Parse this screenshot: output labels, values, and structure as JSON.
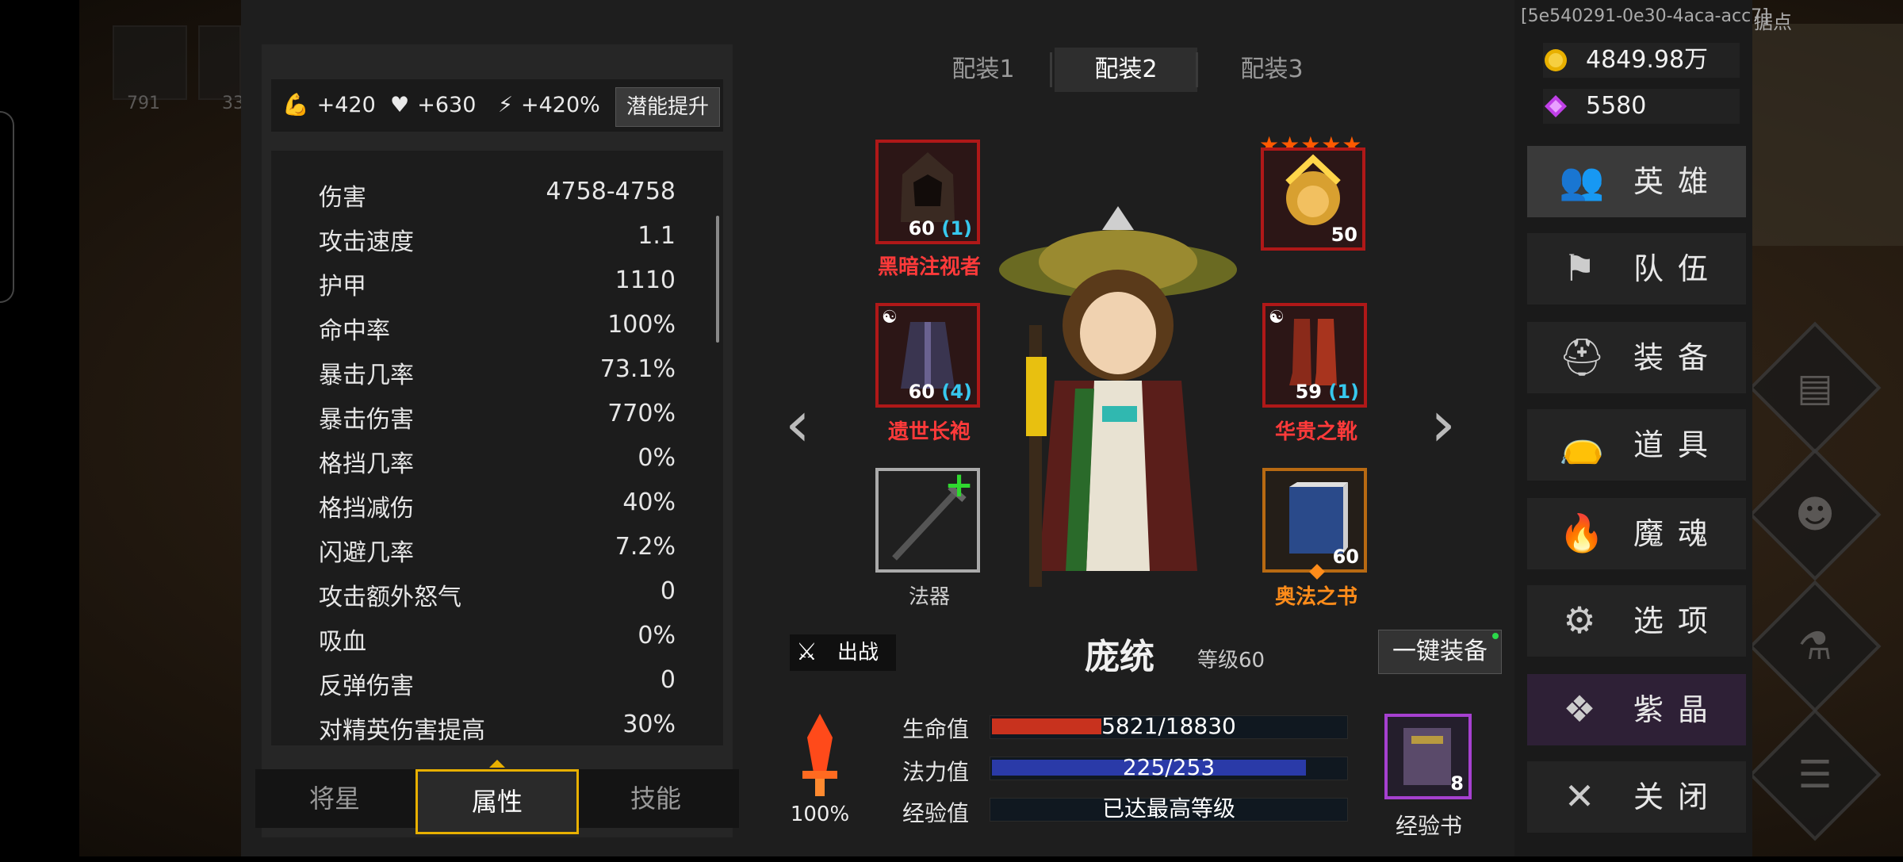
{
  "background": {
    "counts": [
      "791",
      "33"
    ],
    "stronghold_label": "据点"
  },
  "session_id": "[5e540291-0e30-4aca-acc7]",
  "potential": {
    "strength": "+420",
    "health": "+630",
    "energy": "+420%",
    "upgrade_button": "潜能提升"
  },
  "stats": [
    {
      "name": "伤害",
      "value": "4758-4758"
    },
    {
      "name": "攻击速度",
      "value": "1.1"
    },
    {
      "name": "护甲",
      "value": "1110"
    },
    {
      "name": "命中率",
      "value": "100%"
    },
    {
      "name": "暴击几率",
      "value": "73.1%"
    },
    {
      "name": "暴击伤害",
      "value": "770%"
    },
    {
      "name": "格挡几率",
      "value": "0%"
    },
    {
      "name": "格挡减伤",
      "value": "40%"
    },
    {
      "name": "闪避几率",
      "value": "7.2%"
    },
    {
      "name": "攻击额外怒气",
      "value": "0"
    },
    {
      "name": "吸血",
      "value": "0%"
    },
    {
      "name": "反弹伤害",
      "value": "0"
    },
    {
      "name": "对精英伤害提高",
      "value": "30%"
    }
  ],
  "bottom_tabs": [
    "将星",
    "属性",
    "技能"
  ],
  "loadout_tabs": [
    "配装1",
    "配装2",
    "配装3"
  ],
  "equipment": {
    "head": {
      "name": "黑暗注视者",
      "level": "60",
      "plus": "(1)"
    },
    "companion": {
      "level": "50",
      "stars": "★★★★★"
    },
    "body": {
      "name": "遗世长袍",
      "level": "60",
      "plus": "(4)"
    },
    "boots": {
      "name": "华贵之靴",
      "level": "59",
      "plus": "(1)"
    },
    "weapon": {
      "name": "法器"
    },
    "book": {
      "name": "奥法之书",
      "level": "60"
    }
  },
  "hero": {
    "name": "庞统",
    "level": "等级60",
    "deploy_label": "出战",
    "auto_equip": "一键装备"
  },
  "bars": {
    "hp_label": "生命值",
    "hp_text": "5821/18830",
    "hp_fraction": 0.309,
    "mp_label": "法力值",
    "mp_text": "225/253",
    "mp_fraction": 0.889,
    "exp_label": "经验值",
    "exp_text": "已达最高等级"
  },
  "rage_percent": "100%",
  "exp_book": {
    "count": "8",
    "label": "经验书"
  },
  "currency": {
    "gold": "4849.98万",
    "gems": "5580"
  },
  "menu": [
    "英雄",
    "队伍",
    "装备",
    "道具",
    "魔魂",
    "选项",
    "紫晶",
    "关闭"
  ],
  "colors": {
    "accent_gold": "#e8b000",
    "rare_red": "#ff3a3a",
    "legend_orange": "#ff8c1a",
    "hp_red": "#c8321e",
    "mp_blue": "#2a3aa8",
    "amethyst_purple": "#a640d0"
  }
}
